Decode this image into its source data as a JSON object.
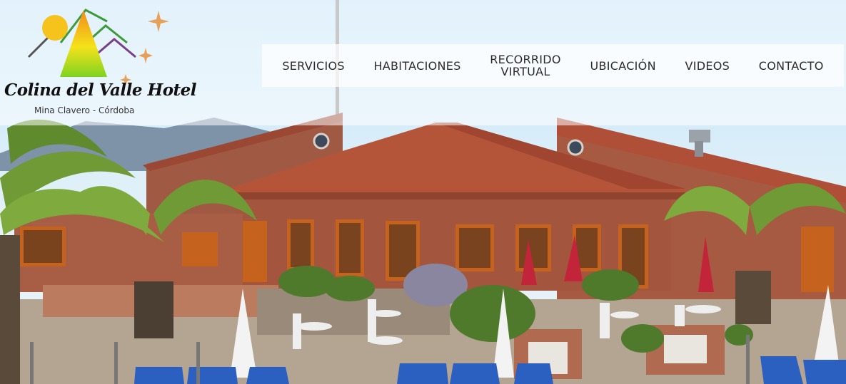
{
  "logo": {
    "title": "Colina del Valle Hotel",
    "subtitle": "Mina Clavero - Córdoba"
  },
  "nav": {
    "items": [
      {
        "label": "SERVICIOS"
      },
      {
        "label": "HABITACIONES"
      },
      {
        "label_line1": "RECORRIDO",
        "label_line2": "VIRTUAL"
      },
      {
        "label": "UBICACIÓN"
      },
      {
        "label": "VIDEOS"
      },
      {
        "label": "CONTACTO"
      }
    ]
  },
  "colors": {
    "roof": "#b4553a",
    "brick": "#a4553e",
    "window_frame": "#c5621e",
    "sky": "#c9e4f5",
    "palm": "#6f9a35",
    "chair": "#2b5fc0",
    "umbrella_red": "#c2253a"
  },
  "icons": [
    "sun-icon",
    "star-icon",
    "triangle-mountain-logo-icon"
  ]
}
